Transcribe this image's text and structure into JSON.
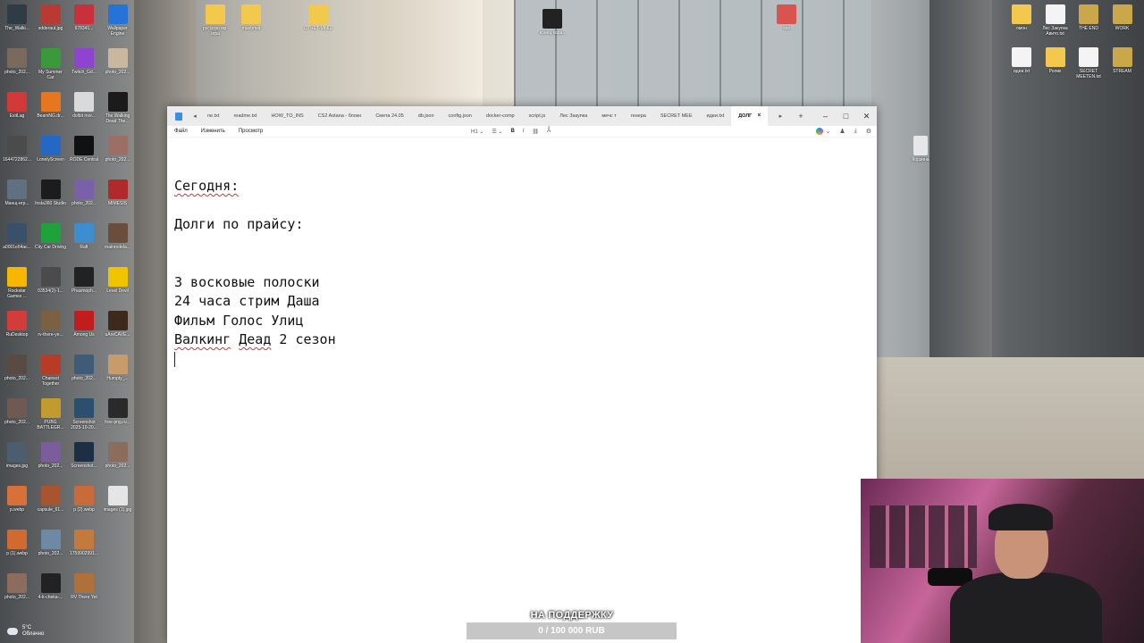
{
  "desktop": {
    "left_icons": [
      {
        "label": "The_Walki...",
        "color": "#2f3b45"
      },
      {
        "label": "sdderaut.jpg",
        "color": "#b93a32"
      },
      {
        "label": "678341...",
        "color": "#c9303b"
      },
      {
        "label": "Wallpaper Engine",
        "color": "#2573d9"
      },
      {
        "label": "photo_202...",
        "color": "#7a6a5c"
      },
      {
        "label": "My Summer Car",
        "color": "#3a9a3a"
      },
      {
        "label": "Twitch_Gd...",
        "color": "#8f44d1"
      },
      {
        "label": "photo_202...",
        "color": "#c8b8a0"
      },
      {
        "label": "ExitLag",
        "color": "#d23a3a"
      },
      {
        "label": "BeamNG.dr...",
        "color": "#e7771f"
      },
      {
        "label": "dolbit mor...",
        "color": "#dadada"
      },
      {
        "label": "The Walking Dead The...",
        "color": "#1b1b1b"
      },
      {
        "label": "1644722862...",
        "color": "#4b4b4b"
      },
      {
        "label": "LonelyScreen",
        "color": "#2567c4"
      },
      {
        "label": "RODE Central",
        "color": "#111111"
      },
      {
        "label": "photo_202...",
        "color": "#9b6f66"
      },
      {
        "label": "Манщ-игр...",
        "color": "#607080"
      },
      {
        "label": "Insta360 Studio",
        "color": "#1c1c1c"
      },
      {
        "label": "photo_202...",
        "color": "#7a5faa"
      },
      {
        "label": "MIMESIS",
        "color": "#b02a2a"
      },
      {
        "label": "a0001e64ac...",
        "color": "#38506a"
      },
      {
        "label": "City Car Driving",
        "color": "#1fa23b"
      },
      {
        "label": "Raft",
        "color": "#3d8ed1"
      },
      {
        "label": "mainrodela...",
        "color": "#6a4e3b"
      },
      {
        "label": "Rockstar Games ...",
        "color": "#f5b700"
      },
      {
        "label": "03534(2)-1...",
        "color": "#4b4b4b"
      },
      {
        "label": "Phasmoph...",
        "color": "#222222"
      },
      {
        "label": "Level Devil",
        "color": "#f0c400"
      },
      {
        "label": "RuDesktop",
        "color": "#d43b3b"
      },
      {
        "label": "rv-there-ye...",
        "color": "#7c6044"
      },
      {
        "label": "Among Us",
        "color": "#c21d1d"
      },
      {
        "label": "uAreCAVE...",
        "color": "#3e2a1d"
      },
      {
        "label": "photo_202...",
        "color": "#5a4a44"
      },
      {
        "label": "Chained Together",
        "color": "#b73b26"
      },
      {
        "label": "photo_202...",
        "color": "#3f5b78"
      },
      {
        "label": "Humpty_...",
        "color": "#c89b6b"
      },
      {
        "label": "photo_202...",
        "color": "#6e5a52"
      },
      {
        "label": "PUBG BATTLEGR...",
        "color": "#c39a2d"
      },
      {
        "label": "Screenshot 2025-10-20...",
        "color": "#2d4f6e"
      },
      {
        "label": "free-png.ru...",
        "color": "#2a2a2a"
      },
      {
        "label": "images.jpg",
        "color": "#4c5d6e"
      },
      {
        "label": "photo_202...",
        "color": "#7b5d9e"
      },
      {
        "label": "Screenshot...",
        "color": "#1d2f44"
      },
      {
        "label": "photo_202...",
        "color": "#8a6d5c"
      },
      {
        "label": "p.webp",
        "color": "#d6713a"
      },
      {
        "label": "capsule_61...",
        "color": "#a8542e"
      },
      {
        "label": "p (2).webp",
        "color": "#c96a3a"
      },
      {
        "label": "images (1).jpg",
        "color": "#e5e5e5"
      },
      {
        "label": "p (1).webp",
        "color": "#cf6a30"
      },
      {
        "label": "photo_202...",
        "color": "#6c8aa6"
      },
      {
        "label": "1759902991...",
        "color": "#c47a3a"
      },
      {
        "label": "",
        "color": "#00000000"
      },
      {
        "label": "photo_202...",
        "color": "#8c6c5a"
      },
      {
        "label": "4-k-cheka-...",
        "color": "#222222"
      },
      {
        "label": "RV There Yet",
        "color": "#b0703a"
      },
      {
        "label": "",
        "color": "#00000000"
      }
    ],
    "top_icons": [
      {
        "label": "русскую мр-ифа",
        "color": "#f2c94c"
      },
      {
        "label": "muobmat",
        "color": "#f2c94c"
      },
      {
        "label": "ОТЧЕТ-МЫШ",
        "color": "#f2c94c"
      },
      {
        "label": "конец кара..",
        "color": "#222222"
      },
      {
        "label": "sss",
        "color": "#d9534f"
      }
    ],
    "right_icons": [
      {
        "label": "омон",
        "color": "#f2c94c"
      },
      {
        "label": "Лес Закупка Авито.txt",
        "color": "#f4f4f4"
      },
      {
        "label": "THE END",
        "color": "#c9a74a"
      },
      {
        "label": "WORK",
        "color": "#c9a74a"
      },
      {
        "label": "идеи.txt",
        "color": "#f4f4f4"
      },
      {
        "label": "Ролик",
        "color": "#f2c94c"
      },
      {
        "label": "SECRET MEETEN.txt",
        "color": "#f4f4f4"
      },
      {
        "label": "STREAM",
        "color": "#c9a74a"
      }
    ],
    "stray_icon_label": "Корзина"
  },
  "window": {
    "tabs": [
      "ne.txt",
      "readme.txt",
      "HOW_TO_INS",
      "CS2 Astana - блокн",
      "Смета 24.05",
      "db.json",
      "config.json",
      "docker-comp",
      "script.js",
      "Лес Закупка",
      "мечс т",
      "генера",
      "SECRET MEE",
      "идеи.txt"
    ],
    "active_tab": "ДОЛГ",
    "close_tab": "×",
    "new_tab": "+",
    "nav_prev": "◂",
    "nav_next": "▸",
    "controls": {
      "minimize": "–",
      "maximize": "□",
      "close": "✕"
    },
    "menu": {
      "file": "Файл",
      "edit": "Изменить",
      "view": "Просмотр"
    },
    "format_tools": {
      "heading": "H1 ⌄",
      "list": "☰ ⌄",
      "bold": "B",
      "italic": "I",
      "link": "⛓",
      "clear": "Aͯ"
    },
    "right_tools": {
      "copilot": "⌄",
      "account": "♟",
      "download": "⤓",
      "settings": "⚙"
    }
  },
  "document": {
    "lines": [
      "Сегодня:",
      "",
      "Долги по прайсу:",
      "",
      "",
      "3 восковые полоски",
      "24 часа стрим Даша",
      "Фильм Голос Улиц",
      "Валкинг Деад 2 сезон"
    ]
  },
  "overlay": {
    "support_title": "НА ПОДДЕРЖКУ",
    "support_progress": "0 / 100 000 RUB",
    "support_fraction": 0
  },
  "weather": {
    "temp": "5°C",
    "condition": "Облачно"
  }
}
